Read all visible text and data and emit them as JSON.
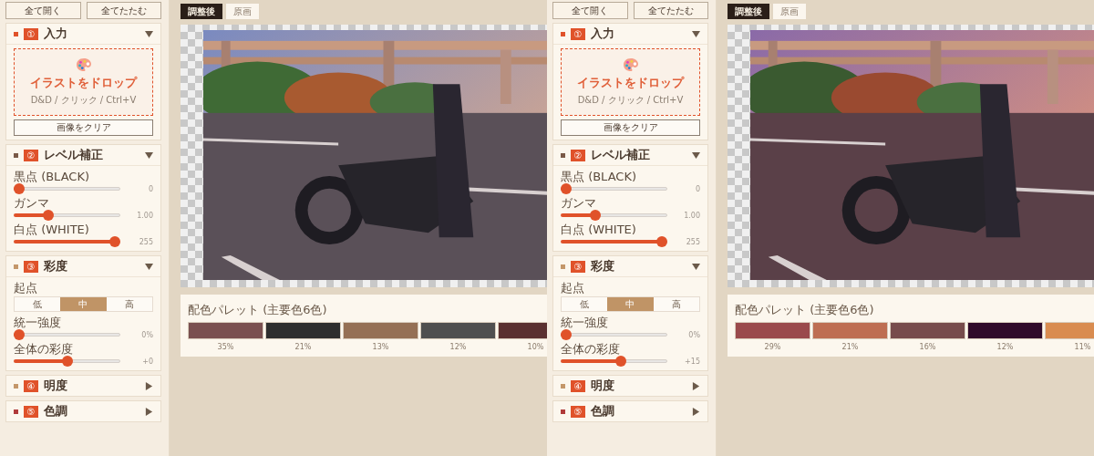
{
  "panes": [
    {
      "sidebar": {
        "buttons": [
          "全て開く",
          "全てたたむ"
        ],
        "sections": [
          {
            "kind": "input",
            "number": "①",
            "title": "入力",
            "color": "#e0522a",
            "expanded": true,
            "drop_title": "イラストをドロップ",
            "drop_hint": "D&D / クリック / Ctrl+V",
            "clear_button": "画像をクリア"
          },
          {
            "kind": "levels",
            "number": "②",
            "title": "レベル補正",
            "color": "#7a5a48",
            "expanded": true,
            "sliders": [
              {
                "label": "黒点 (BLACK)",
                "level": 0,
                "reading": "0"
              },
              {
                "label": "ガンマ",
                "level": 0.3,
                "reading": "1.00"
              },
              {
                "label": "白点 (WHITE)",
                "level": 1,
                "reading": "255"
              }
            ]
          },
          {
            "kind": "saturation",
            "number": "③",
            "title": "彩度",
            "color": "#c4976a",
            "expanded": true,
            "start_label": "起点",
            "segments": [
              {
                "label": "低",
                "selected": false
              },
              {
                "label": "中",
                "selected": true
              },
              {
                "label": "高",
                "selected": false
              }
            ],
            "sliders": [
              {
                "label": "統一強度",
                "level": 0,
                "reading": "0%"
              },
              {
                "label": "全体の彩度",
                "level": 0.5,
                "reading": "+0"
              }
            ]
          },
          {
            "number": "④",
            "title": "明度",
            "color": "#c4976a",
            "expanded": false
          },
          {
            "number": "⑤",
            "title": "色調",
            "color": "#b03a3a",
            "expanded": false
          }
        ]
      },
      "main": {
        "tabs": [
          {
            "label": "調整後",
            "selected": true
          },
          {
            "label": "原画",
            "selected": false
          }
        ],
        "palette": {
          "title": "配色パレット (主要色6色)",
          "swatches": [
            {
              "color": "#7a5050",
              "label": "35%"
            },
            {
              "color": "#2e2e2e",
              "label": "21%"
            },
            {
              "color": "#957055",
              "label": "13%"
            },
            {
              "color": "#4f4f4f",
              "label": "12%"
            },
            {
              "color": "#5a3030",
              "label": "10%"
            }
          ]
        }
      }
    },
    {
      "sidebar": {
        "buttons": [
          "全て開く",
          "全てたたむ"
        ],
        "sections": [
          {
            "kind": "input",
            "number": "①",
            "title": "入力",
            "color": "#e0522a",
            "expanded": true,
            "drop_title": "イラストをドロップ",
            "drop_hint": "D&D / クリック / Ctrl+V",
            "clear_button": "画像をクリア"
          },
          {
            "kind": "levels",
            "number": "②",
            "title": "レベル補正",
            "color": "#7a5a48",
            "expanded": true,
            "sliders": [
              {
                "label": "黒点 (BLACK)",
                "level": 0,
                "reading": "0"
              },
              {
                "label": "ガンマ",
                "level": 0.3,
                "reading": "1.00"
              },
              {
                "label": "白点 (WHITE)",
                "level": 1,
                "reading": "255"
              }
            ]
          },
          {
            "kind": "saturation",
            "number": "③",
            "title": "彩度",
            "color": "#c4976a",
            "expanded": true,
            "start_label": "起点",
            "segments": [
              {
                "label": "低",
                "selected": false
              },
              {
                "label": "中",
                "selected": true
              },
              {
                "label": "高",
                "selected": false
              }
            ],
            "sliders": [
              {
                "label": "統一強度",
                "level": 0,
                "reading": "0%"
              },
              {
                "label": "全体の彩度",
                "level": 0.57,
                "reading": "+15"
              }
            ]
          },
          {
            "number": "④",
            "title": "明度",
            "color": "#c4976a",
            "expanded": false
          },
          {
            "number": "⑤",
            "title": "色調",
            "color": "#b03a3a",
            "expanded": false
          }
        ]
      },
      "main": {
        "tabs": [
          {
            "label": "調整後",
            "selected": true
          },
          {
            "label": "原画",
            "selected": false
          }
        ],
        "palette": {
          "title": "配色パレット (主要色6色)",
          "swatches": [
            {
              "color": "#9a4a4c",
              "label": "29%"
            },
            {
              "color": "#be6e52",
              "label": "21%"
            },
            {
              "color": "#774c4c",
              "label": "16%"
            },
            {
              "color": "#300a2a",
              "label": "12%"
            },
            {
              "color": "#d98c50",
              "label": "11%"
            }
          ]
        }
      }
    }
  ]
}
